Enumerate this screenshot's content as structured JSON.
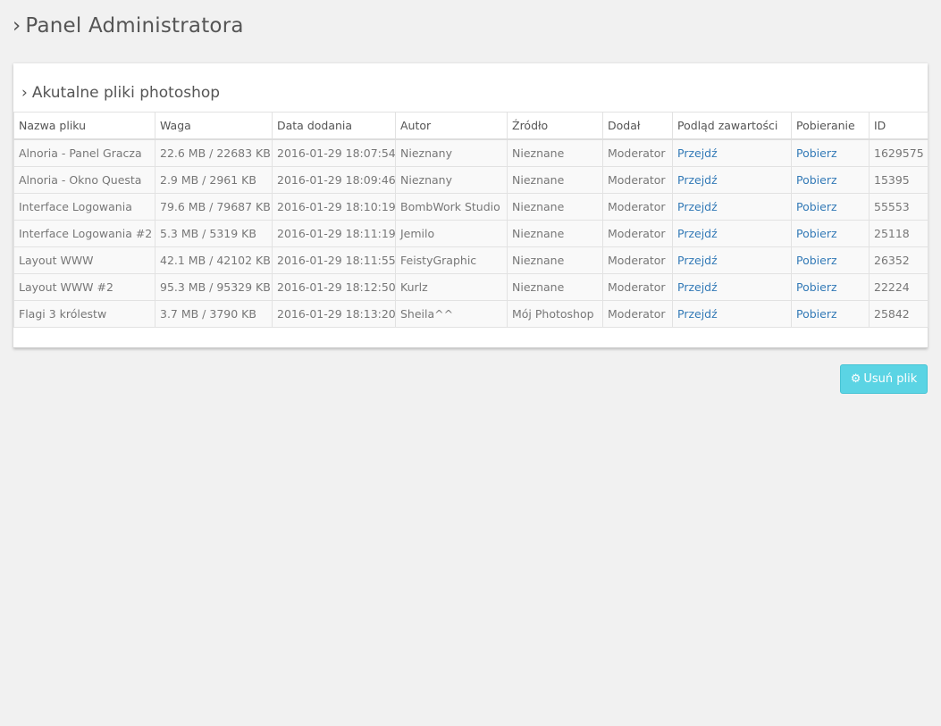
{
  "page": {
    "title": "Panel Administratora",
    "chevron": "›"
  },
  "panel": {
    "title": "Akutalne pliki photoshop",
    "chevron": "›"
  },
  "table": {
    "headers": [
      "Nazwa pliku",
      "Waga",
      "Data dodania",
      "Autor",
      "Źródło",
      "Dodał",
      "Podląd zawartości",
      "Pobieranie",
      "ID"
    ],
    "rows": [
      [
        "Alnoria - Panel Gracza",
        "22.6 MB / 22683 KB",
        "2016-01-29 18:07:54",
        "Nieznany",
        "Nieznane",
        "Moderator",
        "Przejdź",
        "Pobierz",
        "1629575"
      ],
      [
        "Alnoria - Okno Questa",
        "2.9 MB / 2961 KB",
        "2016-01-29 18:09:46",
        "Nieznany",
        "Nieznane",
        "Moderator",
        "Przejdź",
        "Pobierz",
        "15395"
      ],
      [
        "Interface Logowania",
        "79.6 MB / 79687 KB",
        "2016-01-29 18:10:19",
        "BombWork Studio",
        "Nieznane",
        "Moderator",
        "Przejdź",
        "Pobierz",
        "55553"
      ],
      [
        "Interface Logowania #2",
        "5.3 MB / 5319 KB",
        "2016-01-29 18:11:19",
        "Jemilo",
        "Nieznane",
        "Moderator",
        "Przejdź",
        "Pobierz",
        "25118"
      ],
      [
        "Layout WWW",
        "42.1 MB / 42102 KB",
        "2016-01-29 18:11:55",
        "FeistyGraphic",
        "Nieznane",
        "Moderator",
        "Przejdź",
        "Pobierz",
        "26352"
      ],
      [
        "Layout WWW #2",
        "95.3 MB / 95329 KB",
        "2016-01-29 18:12:50",
        "Kurlz",
        "Nieznane",
        "Moderator",
        "Przejdź",
        "Pobierz",
        "22224"
      ],
      [
        "Flagi 3 królestw",
        "3.7 MB / 3790 KB",
        "2016-01-29 18:13:20",
        "Sheila^^",
        "Mój Photoshop",
        "Moderator",
        "Przejdź",
        "Pobierz",
        "25842"
      ]
    ]
  },
  "actions": {
    "delete_label": "Usuń plik",
    "delete_icon": "gear-icon"
  },
  "colors": {
    "link": "#337ab7",
    "button": "#5bd4e4"
  }
}
